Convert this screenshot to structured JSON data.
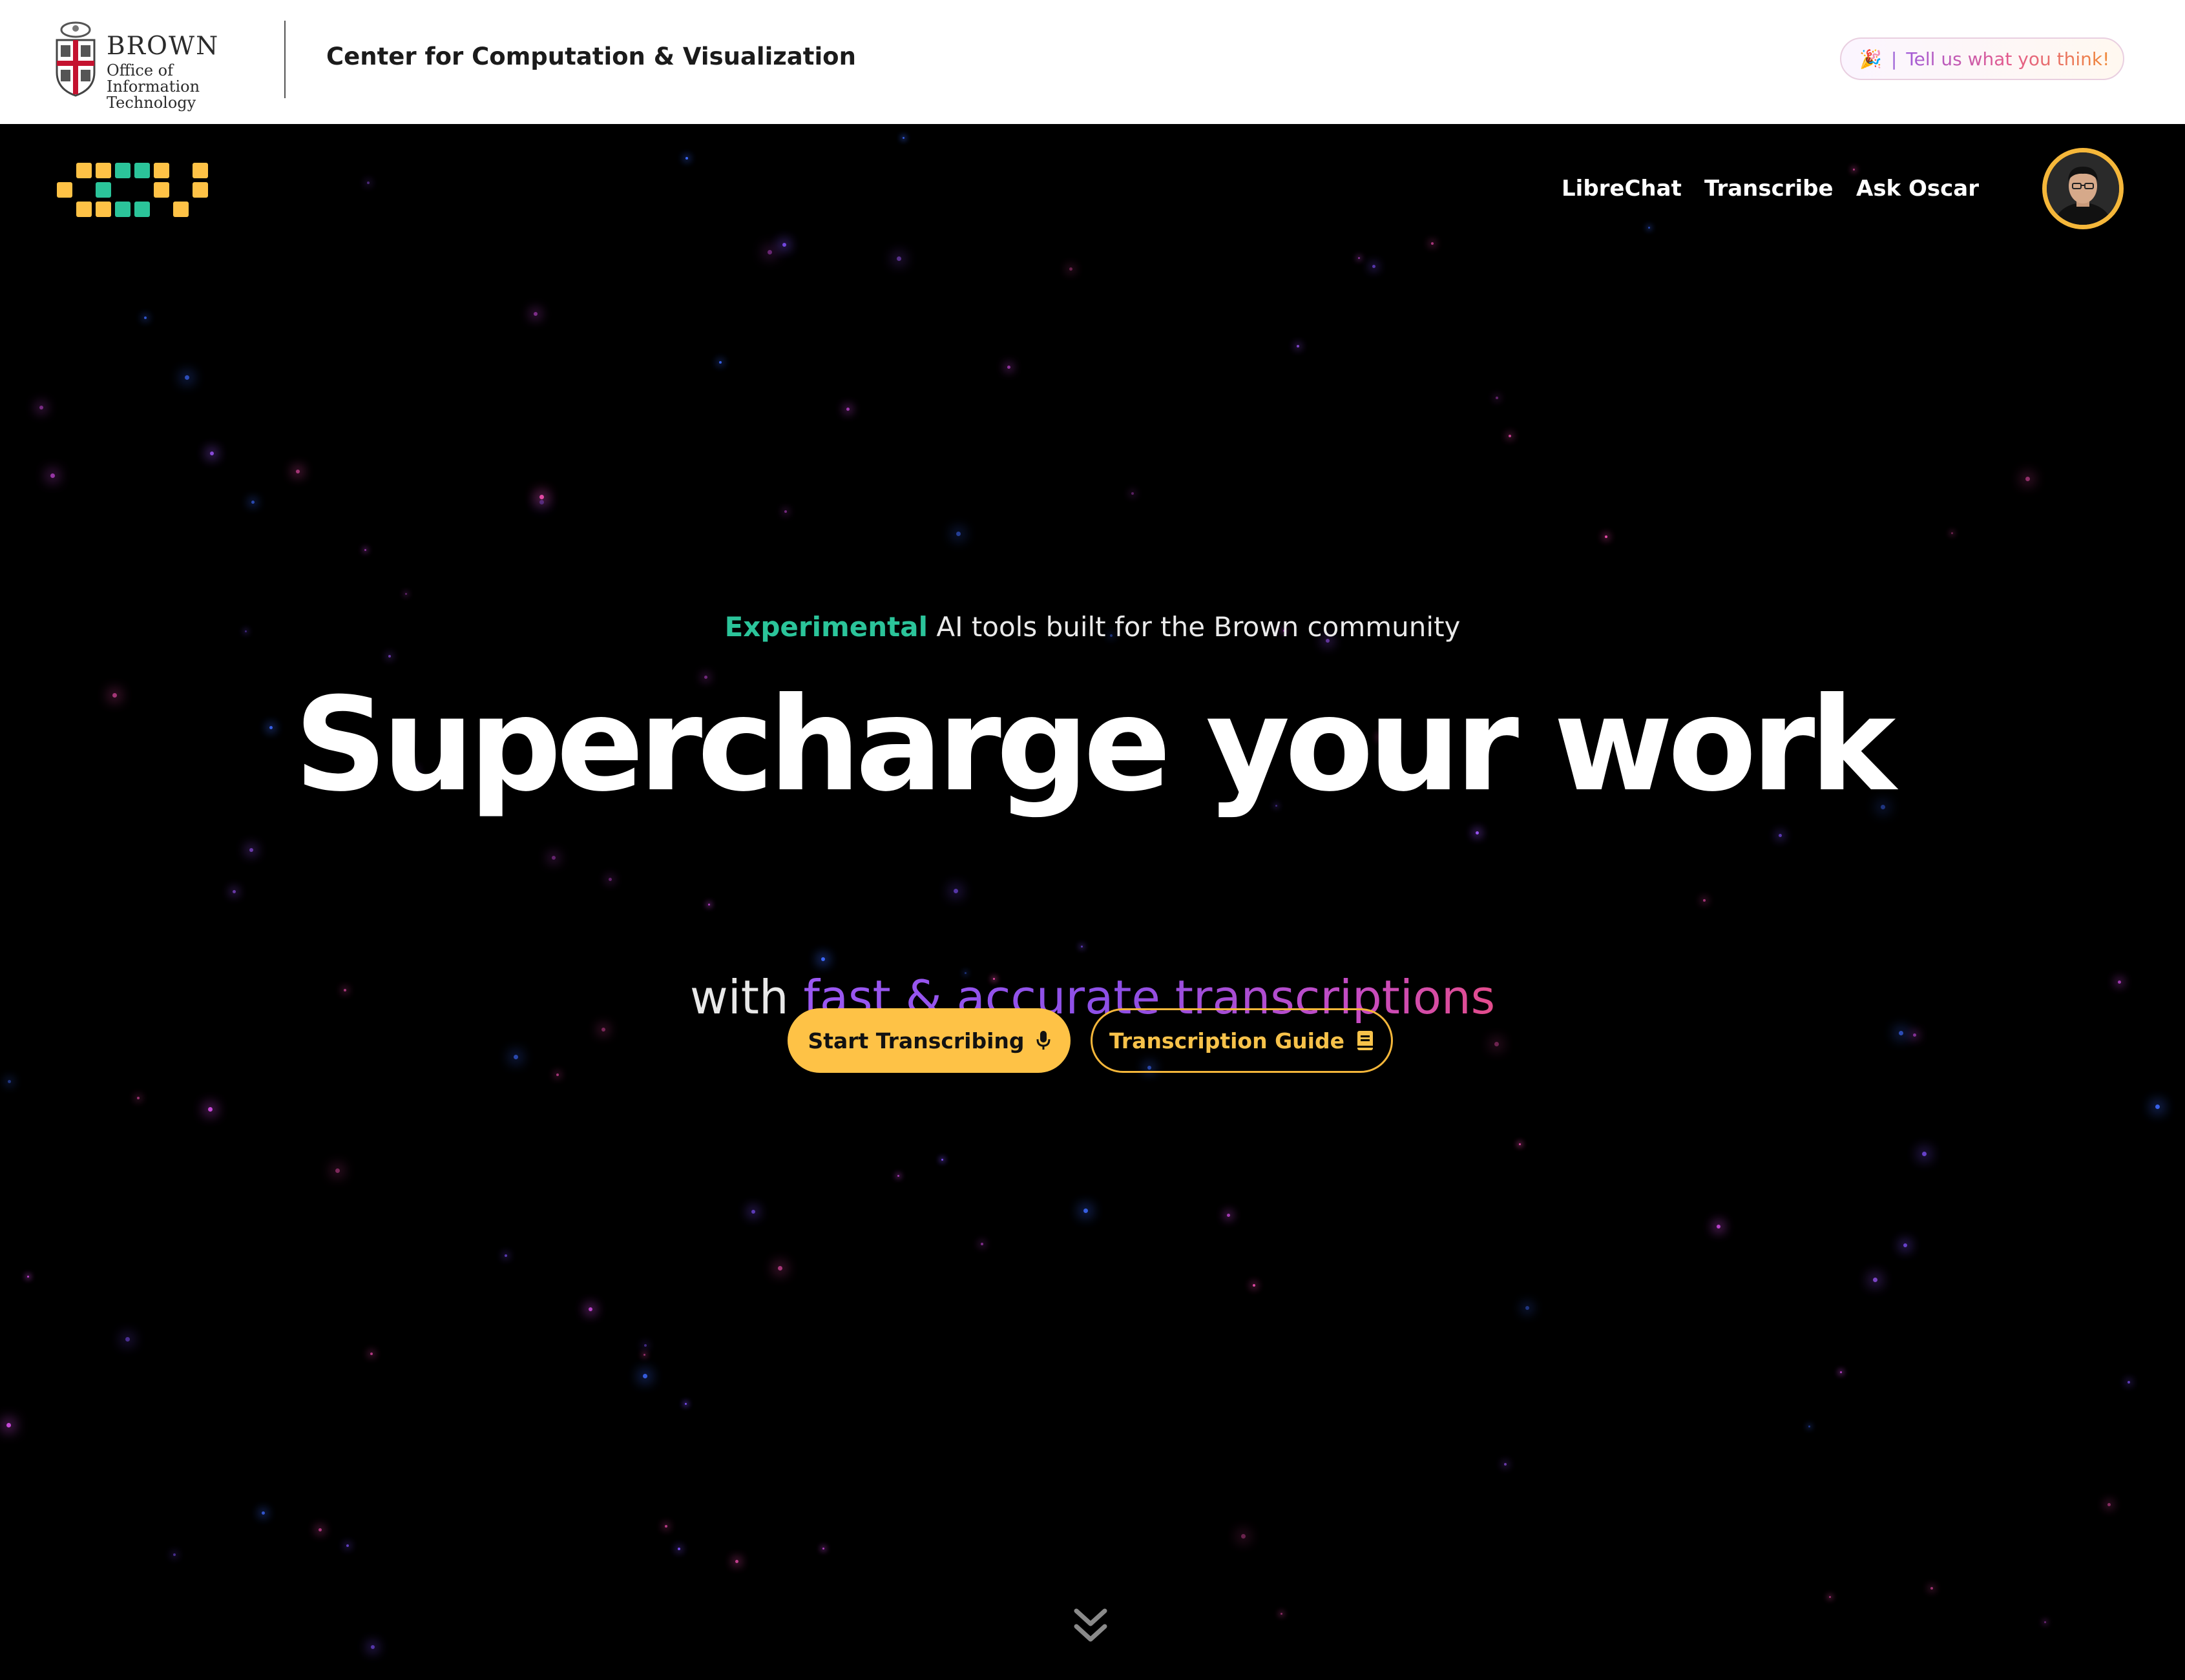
{
  "topbar": {
    "brown_word": "BROWN",
    "brown_sub": "Office of Information Technology",
    "center_title": "Center for Computation & Visualization",
    "feedback": {
      "emoji": "🎉",
      "separator": "|",
      "label": "Tell us what you think!"
    }
  },
  "nav": {
    "links": [
      "LibreChat",
      "Transcribe",
      "Ask Oscar"
    ]
  },
  "hero": {
    "eyebrow_accent": "Experimental",
    "eyebrow_rest": " AI tools built for the Brown community",
    "headline": "Supercharge your work",
    "subline_prefix": "with ",
    "subline_highlight": "fast & accurate transcriptions"
  },
  "buttons": {
    "primary_label": "Start Transcribing",
    "secondary_label": "Transcription Guide"
  },
  "colors": {
    "accent_green": "#2bc49a",
    "brand_yellow": "#fec246",
    "gradient_purple": "#9b58f2",
    "gradient_pink": "#e44c8b"
  },
  "icons": {
    "primary_button": "microphone-icon",
    "secondary_button": "book-icon",
    "scroll": "chevron-double-down-icon"
  }
}
